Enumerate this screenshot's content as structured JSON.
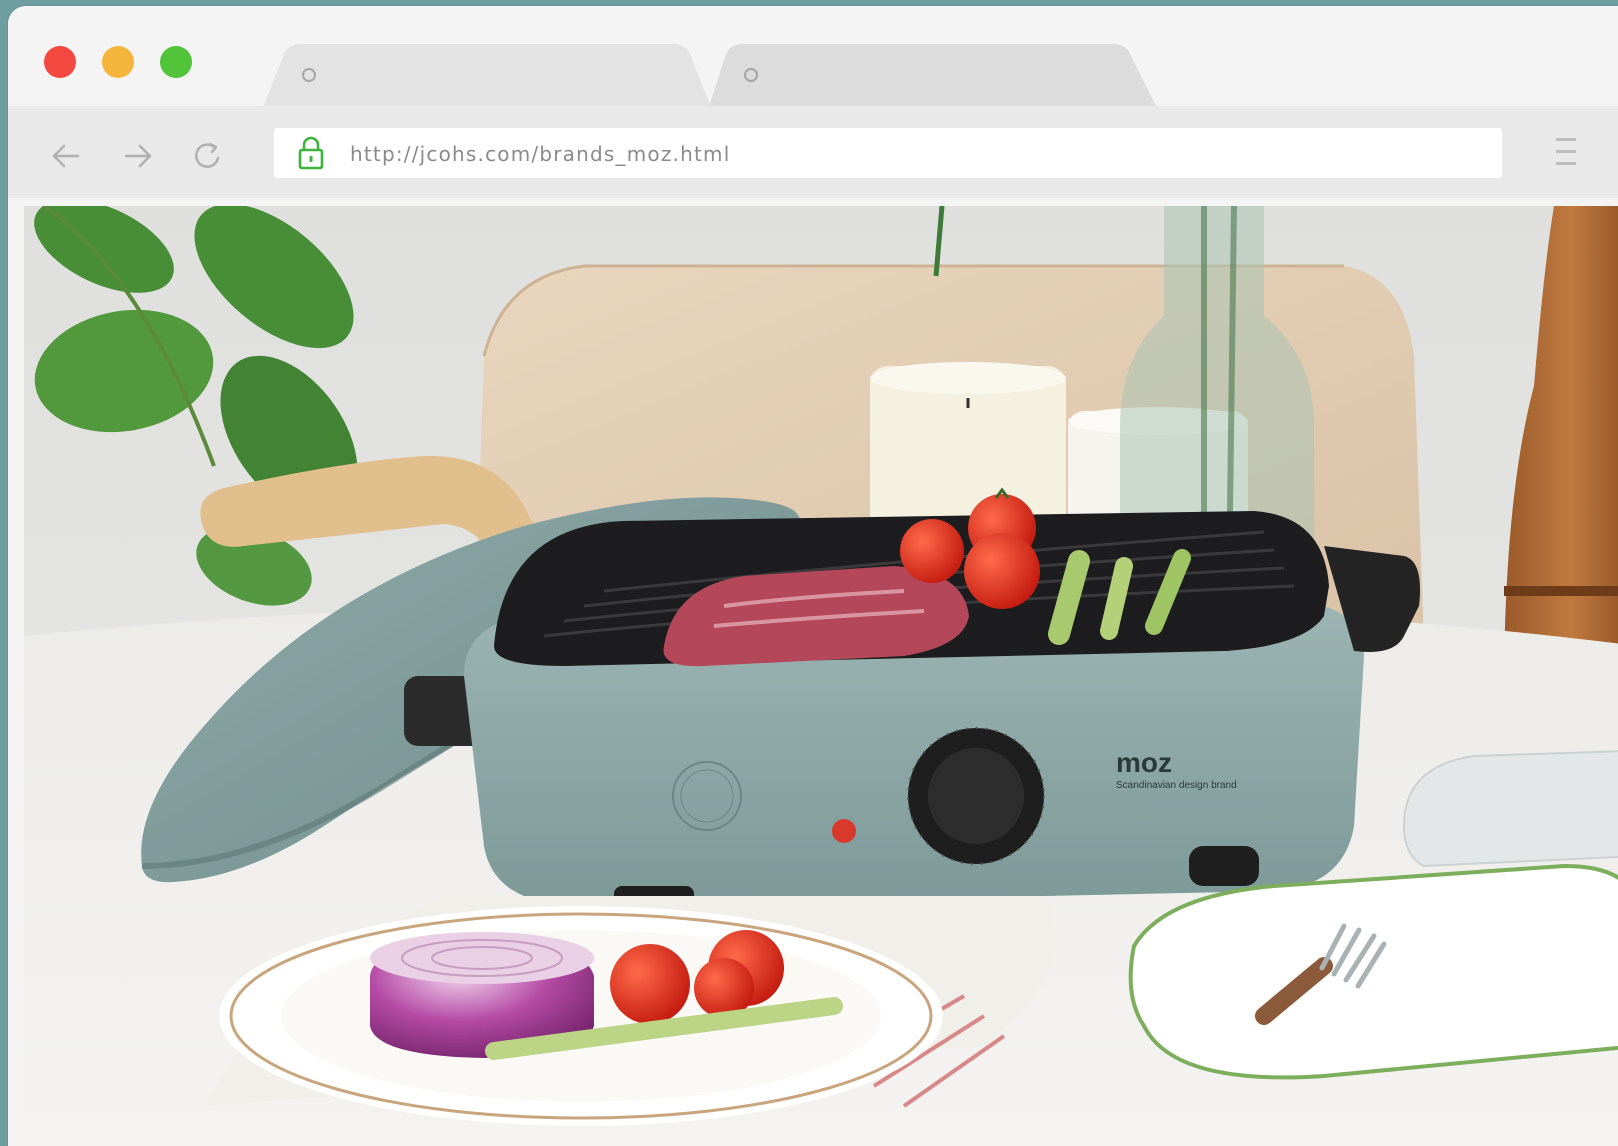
{
  "window": {
    "controls": [
      "close",
      "minimize",
      "maximize"
    ]
  },
  "tabs": [
    {
      "label": "",
      "icon": "tab-dot-icon"
    },
    {
      "label": "",
      "icon": "tab-dot-icon"
    }
  ],
  "toolbar": {
    "back_icon": "arrow-left-icon",
    "forward_icon": "arrow-right-icon",
    "reload_icon": "reload-icon",
    "menu_icon": "hamburger-icon"
  },
  "address_bar": {
    "url": "http://jcohs.com/brands_moz.html",
    "lock_icon": "lock-icon",
    "lock_color": "#3db33b"
  },
  "page": {
    "hero_image": {
      "brand_logo": "moz",
      "brand_tagline": "Scandinavian design brand"
    }
  },
  "colors": {
    "frame": "#6e9ea0",
    "product": "#8aa6a5",
    "accent_red": "#f3483f",
    "accent_yellow": "#f5b53a",
    "accent_green": "#52c43a"
  }
}
